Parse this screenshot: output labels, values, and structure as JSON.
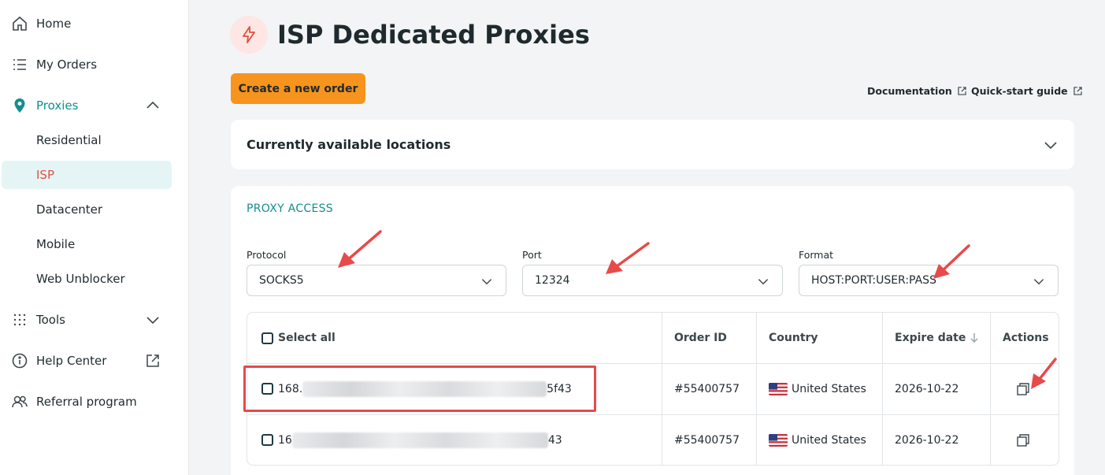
{
  "sidebar": {
    "home": "Home",
    "orders": "My Orders",
    "proxies": "Proxies",
    "sub": [
      "Residential",
      "ISP",
      "Datacenter",
      "Mobile",
      "Web Unblocker"
    ],
    "tools": "Tools",
    "help": "Help Center",
    "referral": "Referral program"
  },
  "page": {
    "title": "ISP Dedicated Proxies",
    "create_button": "Create a new order",
    "documentation": "Documentation",
    "quickstart": "Quick-start guide"
  },
  "locations": {
    "title": "Currently available locations"
  },
  "access": {
    "label": "PROXY ACCESS",
    "protocol": {
      "label": "Protocol",
      "value": "SOCKS5"
    },
    "port": {
      "label": "Port",
      "value": "12324"
    },
    "format": {
      "label": "Format",
      "value": "HOST:PORT:USER:PASS"
    }
  },
  "table": {
    "headers": {
      "select_all": "Select all",
      "order_id": "Order ID",
      "country": "Country",
      "expire": "Expire date",
      "actions": "Actions"
    },
    "rows": [
      {
        "proxy_start": "168.",
        "proxy_end": "5f43",
        "order_id": "#55400757",
        "country": "United States",
        "expire": "2026-10-22"
      },
      {
        "proxy_start": "16",
        "proxy_end": "43",
        "order_id": "#55400757",
        "country": "United States",
        "expire": "2026-10-22"
      }
    ]
  },
  "colors": {
    "accent": "#138e8e",
    "cta": "#f7941d",
    "active_text": "#e0513f",
    "annotation": "#e74a4a"
  }
}
